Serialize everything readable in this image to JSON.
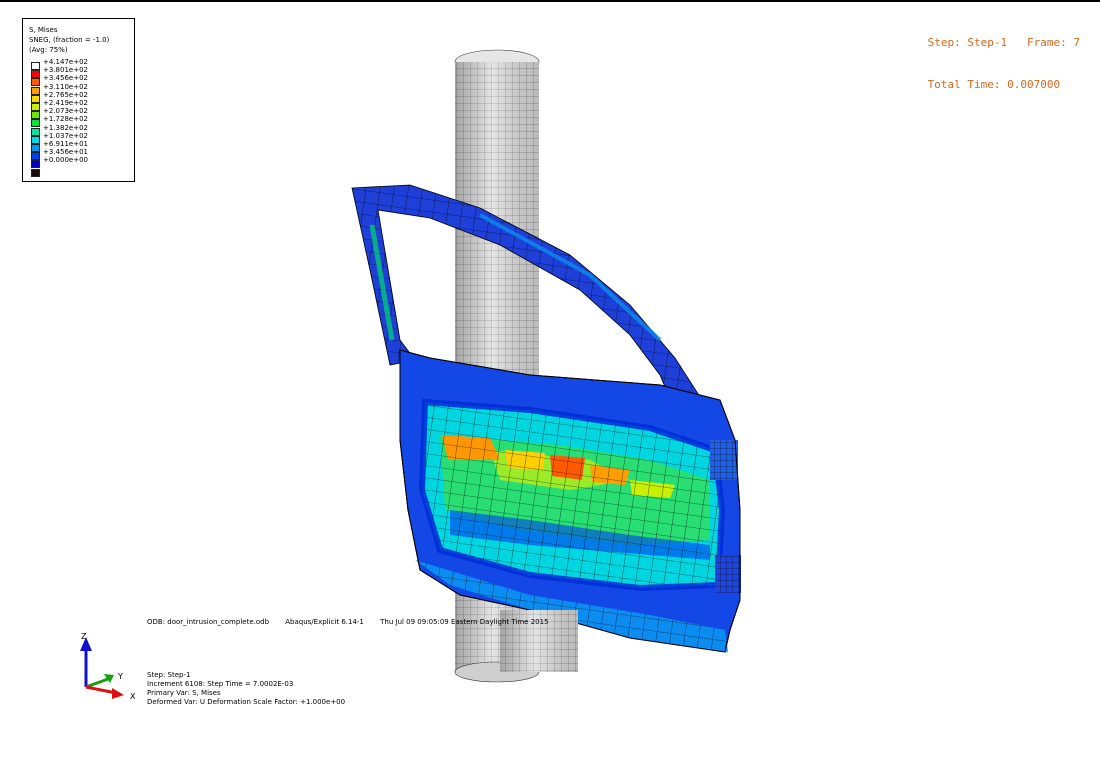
{
  "legend": {
    "title": "S, Mises",
    "subtitle": "SNEG, (fraction = -1.0)",
    "avg": "(Avg: 75%)",
    "entries": [
      {
        "label": "+4.147e+02",
        "color": "#ffffff"
      },
      {
        "label": "+3.801e+02",
        "color": "#ff0000"
      },
      {
        "label": "+3.456e+02",
        "color": "#ff5a00"
      },
      {
        "label": "+3.110e+02",
        "color": "#ff9e00"
      },
      {
        "label": "+2.765e+02",
        "color": "#ffd700"
      },
      {
        "label": "+2.419e+02",
        "color": "#c8f000"
      },
      {
        "label": "+2.073e+02",
        "color": "#6ee600"
      },
      {
        "label": "+1.728e+02",
        "color": "#00e03c"
      },
      {
        "label": "+1.382e+02",
        "color": "#00e6a0"
      },
      {
        "label": "+1.037e+02",
        "color": "#00d8e6"
      },
      {
        "label": "+6.911e+01",
        "color": "#0096f0"
      },
      {
        "label": "+3.456e+01",
        "color": "#0040f0"
      },
      {
        "label": "+0.000e+00",
        "color": "#0000c8"
      },
      {
        "label": "",
        "color": "#1a0a0a"
      }
    ]
  },
  "step_info": {
    "step": "Step: Step-1",
    "frame": "Frame: 7",
    "total_time": "Total Time: 0.007000"
  },
  "odb_line": {
    "file": "ODB: door_intrusion_complete.odb",
    "solver": "Abaqus/Explicit 6.14-1",
    "date": "Thu Jul 09 09:05:09 Eastern Daylight Time 2015"
  },
  "status": {
    "step": "Step: Step-1",
    "increment": "Increment     6108: Step Time =    7.0002E-03",
    "primary_var": "Primary Var: S, Mises",
    "deformed_var": "Deformed Var: U   Deformation Scale Factor: +1.000e+00"
  },
  "triad": {
    "z": "Z",
    "y": "Y",
    "x": "X",
    "z_color": "#1010d0",
    "y_color": "#10a010",
    "x_color": "#e01010"
  },
  "colors": {
    "pole": "#d8d8d8",
    "mesh": "#000000",
    "accent": "#d2691e"
  }
}
